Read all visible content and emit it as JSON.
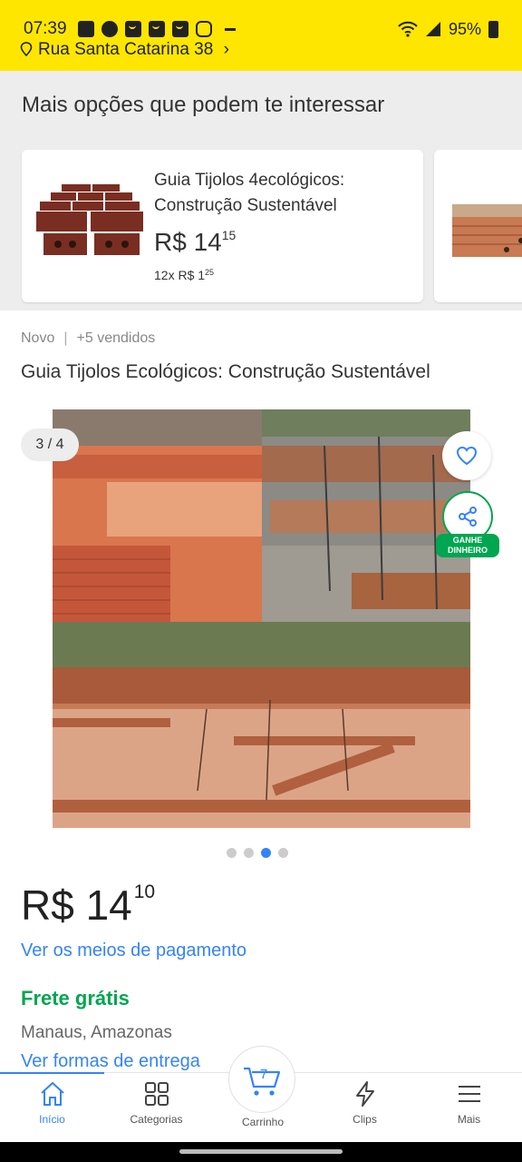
{
  "status_bar": {
    "time": "07:39",
    "battery": "95%",
    "icons": [
      "facebook-icon",
      "chat-icon",
      "app-icon",
      "app-icon",
      "app-icon",
      "cloud-icon",
      "wifi-icon",
      "signal-icon",
      "battery-icon"
    ]
  },
  "header": {
    "address": "Rua Santa Catarina 38"
  },
  "recommendations": {
    "title": "Mais opções que podem te interessar",
    "items": [
      {
        "title": "Guia Tijolos 4ecológicos: Construção Sustentável",
        "price_prefix": "R$ 14",
        "price_cents": "15",
        "installments_prefix": "12x R$ 1",
        "installments_cents": "25"
      }
    ]
  },
  "product": {
    "condition": "Novo",
    "separator": "|",
    "sold": "+5 vendidos",
    "title": "Guia Tijolos Ecológicos: Construção Sustentável",
    "image_counter": "3 / 4",
    "share_badge_line1": "GANHE",
    "share_badge_line2": "DINHEIRO",
    "image_count": 4,
    "active_image": 3,
    "price_prefix": "R$ 14",
    "price_cents": "10",
    "payment_link": "Ver os meios de pagamento",
    "shipping": "Frete grátis",
    "location": "Manaus, Amazonas",
    "shipping_link": "Ver formas de entrega"
  },
  "bottom_nav": {
    "items": [
      {
        "label": "Início",
        "icon": "home-icon"
      },
      {
        "label": "Categorias",
        "icon": "grid-icon"
      },
      {
        "label": "Carrinho",
        "icon": "cart-icon",
        "badge": "7"
      },
      {
        "label": "Clips",
        "icon": "lightning-icon"
      },
      {
        "label": "Mais",
        "icon": "menu-icon"
      }
    ]
  },
  "colors": {
    "brand_yellow": "#fee600",
    "link_blue": "#3483fa",
    "green": "#00a650"
  }
}
